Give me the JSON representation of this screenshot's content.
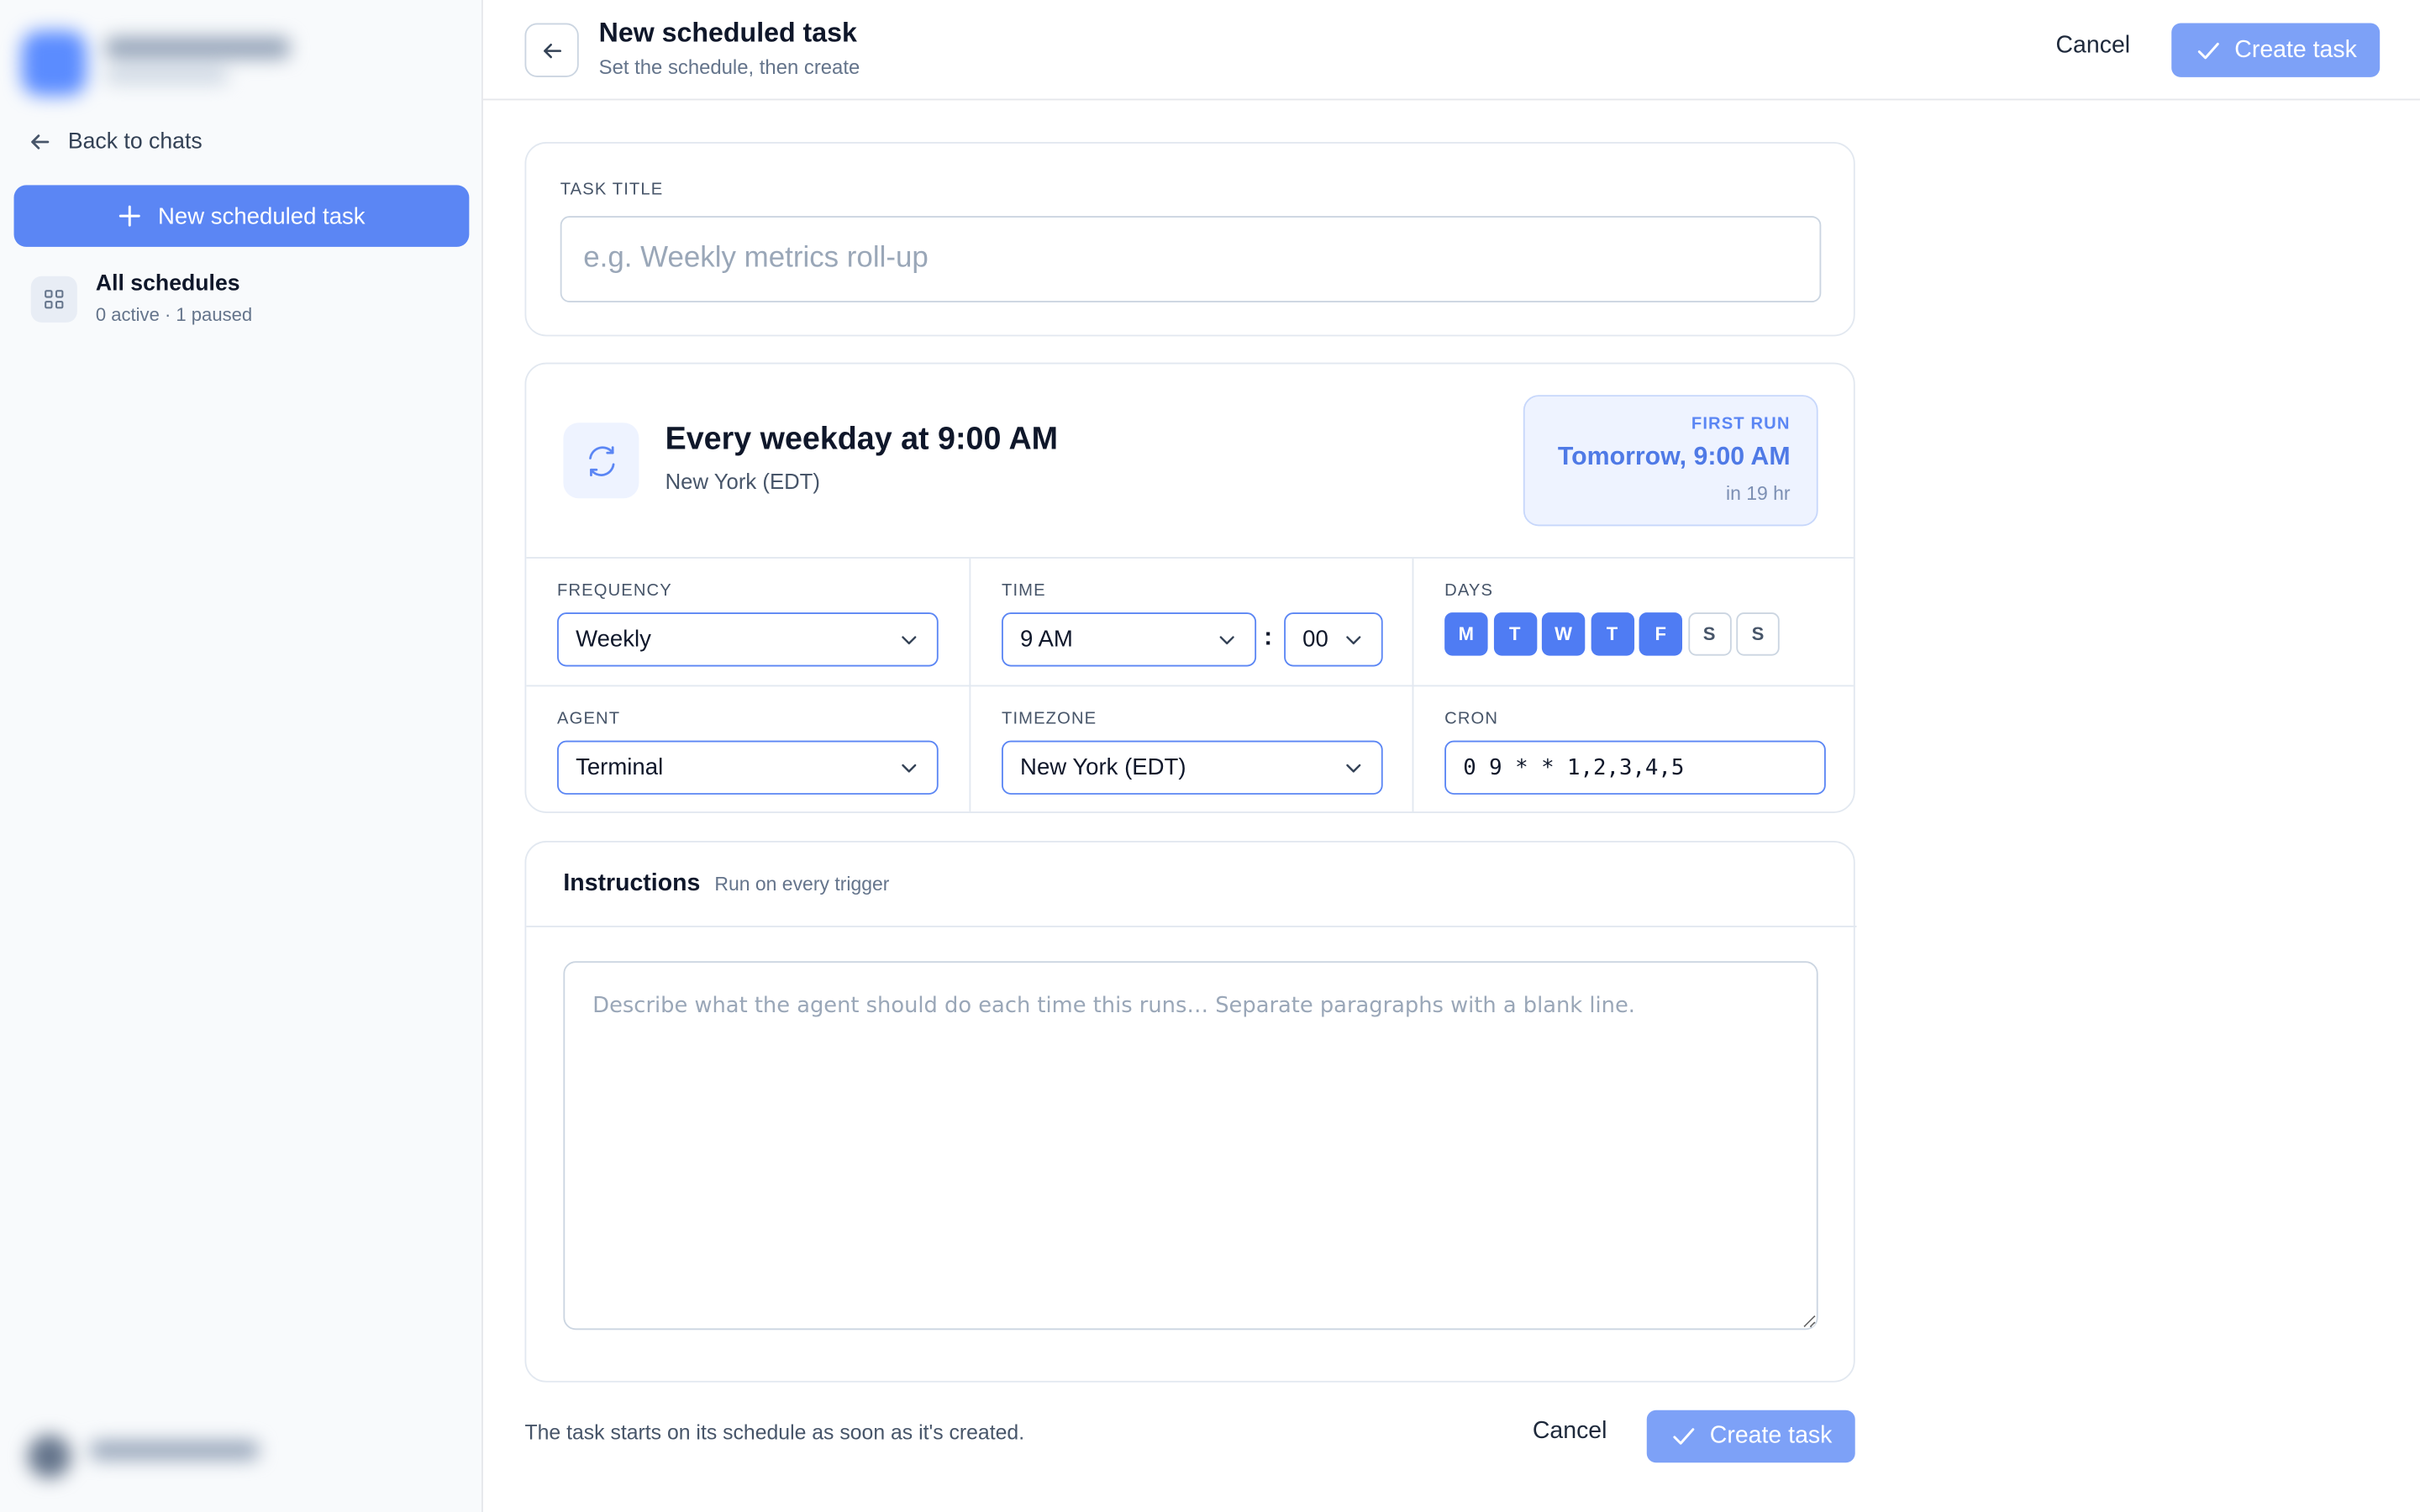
{
  "sidebar": {
    "back_label": "Back to chats",
    "new_task_label": "New scheduled task",
    "schedules": {
      "title": "All schedules",
      "subtitle": "0 active · 1 paused"
    }
  },
  "header": {
    "title": "New scheduled task",
    "subtitle": "Set the schedule, then create",
    "cancel_label": "Cancel",
    "create_label": "Create task"
  },
  "task_title": {
    "label": "TASK TITLE",
    "value": "",
    "placeholder": "e.g. Weekly metrics roll-up"
  },
  "summary": {
    "title": "Every weekday at 9:00 AM",
    "timezone": "New York (EDT)",
    "first_run_label": "FIRST RUN",
    "first_run_value": "Tomorrow, 9:00 AM",
    "first_run_relative": "in 19 hr"
  },
  "fields": {
    "frequency": {
      "label": "FREQUENCY",
      "value": "Weekly"
    },
    "time": {
      "label": "TIME",
      "hour": "9 AM",
      "separator": ":",
      "minute": "00"
    },
    "days": {
      "label": "DAYS",
      "items": [
        {
          "label": "M",
          "selected": true
        },
        {
          "label": "T",
          "selected": true
        },
        {
          "label": "W",
          "selected": true
        },
        {
          "label": "T",
          "selected": true
        },
        {
          "label": "F",
          "selected": true
        },
        {
          "label": "S",
          "selected": false
        },
        {
          "label": "S",
          "selected": false
        }
      ]
    },
    "agent": {
      "label": "AGENT",
      "value": "Terminal"
    },
    "timezone": {
      "label": "TIMEZONE",
      "value": "New York (EDT)"
    },
    "cron": {
      "label": "CRON",
      "value": "0 9 * * 1,2,3,4,5"
    }
  },
  "instructions": {
    "title": "Instructions",
    "subtitle": "Run on every trigger",
    "value": "",
    "placeholder": "Describe what the agent should do each time this runs… Separate paragraphs with a blank line."
  },
  "footer": {
    "note": "The task starts on its schedule as soon as it's created.",
    "cancel_label": "Cancel",
    "create_label": "Create task"
  },
  "colors": {
    "accent": "#5b86f4",
    "accent_disabled": "#7da1f7",
    "day_selected": "#4f7cf3",
    "first_run_bg": "#eef3ff"
  },
  "icons": {
    "back": "arrow-left-icon",
    "plus": "plus-icon",
    "grid": "grid-icon",
    "check": "check-icon",
    "repeat": "repeat-icon",
    "chevron": "chevron-down-icon"
  }
}
